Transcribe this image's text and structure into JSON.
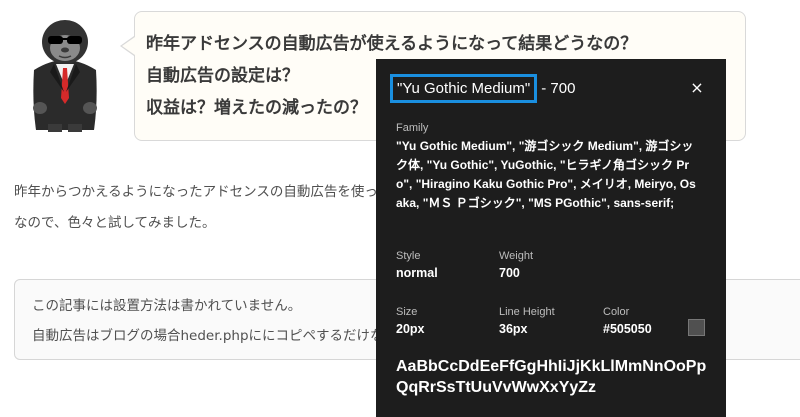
{
  "bubble": {
    "lines": [
      "昨年アドセンスの自動広告が使えるようになって結果どうなの？",
      "自動広告の設定は？",
      "収益は？増えたの減ったの？"
    ]
  },
  "article": {
    "paragraph1": "昨年からつかえるようになったアドセンスの自動広告を使ってみましたが、そう甘くはありません。",
    "paragraph2": "なので、色々と試してみました。"
  },
  "note": {
    "line1": "この記事には設置方法は書かれていません。",
    "line2": "自動広告はブログの場合heder.phpににコピペするだけなので、Googleで参照してください。"
  },
  "inspector": {
    "font_name": "\"Yu Gothic Medium\"",
    "weight_suffix": "- 700",
    "close_glyph": "×",
    "family_label": "Family",
    "family_value": "\"Yu Gothic Medium\", \"游ゴシック Medium\", 游ゴシック体, \"Yu Gothic\", YuGothic, \"ヒラギノ角ゴシック Pro\", \"Hiragino Kaku Gothic Pro\", メイリオ, Meiryo, Osaka, \"ＭＳ Ｐゴシック\", \"MS PGothic\", sans-serif;",
    "style_label": "Style",
    "style_value": "normal",
    "weight_label": "Weight",
    "weight_value": "700",
    "size_label": "Size",
    "size_value": "20px",
    "lineheight_label": "Line Height",
    "lineheight_value": "36px",
    "color_label": "Color",
    "color_value": "#505050",
    "sample": "AaBbCcDdEeFfGgHhIiJjKkLlMmNnOoPpQqRrSsTtUuVvWwXxYyZz"
  },
  "colors": {
    "text": "#505050",
    "inspector_bg": "#1d1d1d",
    "highlight": "#1a8fe0",
    "swatch": "#505050"
  },
  "icons": [
    "gorilla-mascot-icon",
    "close-icon"
  ]
}
